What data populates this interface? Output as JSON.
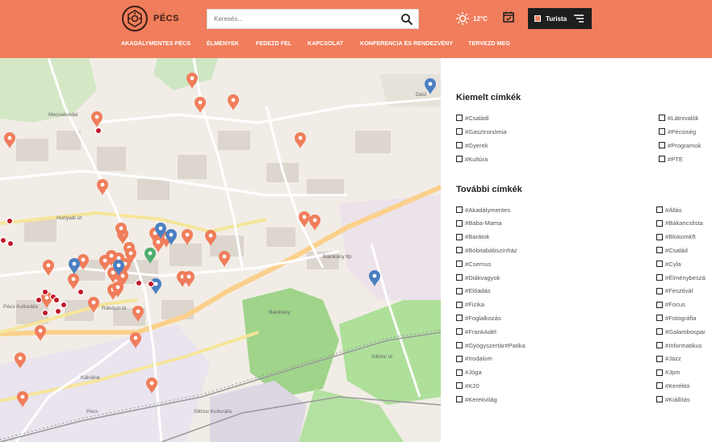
{
  "brand": {
    "name": "PÉCS"
  },
  "search": {
    "placeholder": "Keresés..."
  },
  "weather": {
    "temp": "12°C"
  },
  "user": {
    "label": "Turista"
  },
  "nav": [
    "AKADÁLYMENTES PÉCS",
    "ÉLMÉNYEK",
    "FEDEZD FEL",
    "KAPCSOLAT",
    "KONFERENCIA ÉS RENDEZVÉNY",
    "TERVEZD MEG"
  ],
  "colors": {
    "accent": "#f07d5b",
    "dark": "#1e1e1e",
    "pin_orange": "#f07d5b",
    "pin_blue": "#4a7fc1",
    "pin_green": "#4caf6e",
    "pin_red": "#c0192b"
  },
  "map": {
    "labels": [
      "Mecsekoldal",
      "Pécs Kulturális",
      "Balokány",
      "Siklósi Kulturális",
      "Pécs",
      "Dési",
      "Bálokány ltp",
      "Rákóczi út",
      "Siklósi út",
      "Hunyadi út",
      "Kálvária"
    ]
  },
  "panel": {
    "featured_title": "Kiemelt címkék",
    "featured_left": [
      "#Családi",
      "#Gasztronómia",
      "#Gyerek",
      "#Kultúra"
    ],
    "featured_right": [
      "#Látnivalók",
      "#Pécsiség",
      "#Programok",
      "#PTE"
    ],
    "more_title": "További címkék",
    "more_left": [
      "#Akadálymentes",
      "#Baba-Mama",
      "#Barátok",
      "#Bóbitabábszínház",
      "#Csernus",
      "#Diákvagyok",
      "#Előadás",
      "#Fizika",
      "#Foglalkozás",
      "#FrankAdél",
      "#Gyógyszertár#Patika",
      "#Irodalom",
      "#Jóga",
      "#K20",
      "#Kerekvilág"
    ],
    "more_right": [
      "#Állás",
      "#Bakancslista",
      "#Blokomkft",
      "#Család",
      "#Cyla",
      "#Élménybeszá",
      "#Fesztivál",
      "#Focus",
      "#Fotográfia",
      "#Galambospar",
      "#Informatikus",
      "#Jazz",
      "#Jpm",
      "#Keréktó",
      "#Kiállítás"
    ]
  }
}
